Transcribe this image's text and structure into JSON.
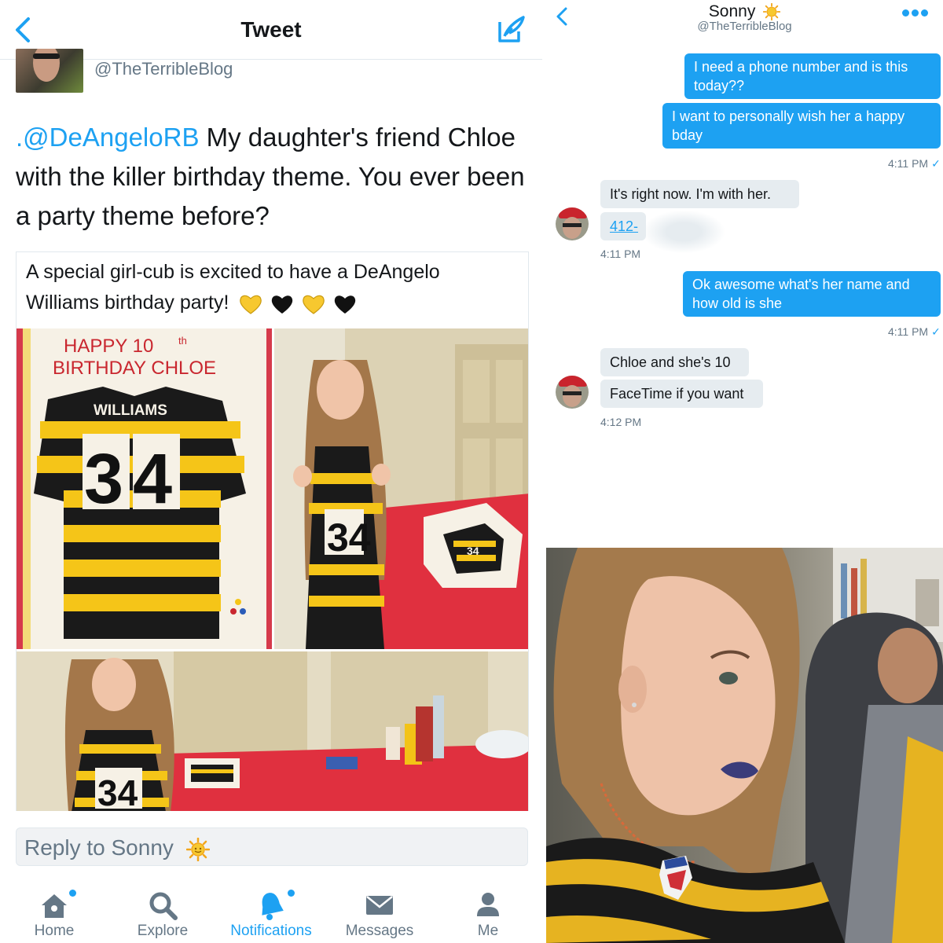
{
  "tweet_view": {
    "header": {
      "title": "Tweet"
    },
    "author": {
      "handle": "@TheTerribleBlog"
    },
    "tweet": {
      "mention": ".@DeAngeloRB",
      "body": " My daughter's friend Chloe with the killer birthday theme. You ever been a party theme before?"
    },
    "quoted": {
      "text": "A special girl-cub is excited to have a DeAngelo Williams birthday party!",
      "hearts": [
        "yellow",
        "black",
        "yellow",
        "black"
      ]
    },
    "photos": {
      "cake": {
        "line1": "HAPPY  10",
        "line1_sup": "th",
        "line2": "BIRTHDAY CHLOE",
        "name": "WILLIAMS",
        "number": "34"
      },
      "girl": {
        "number": "34"
      },
      "table": {
        "number": "34"
      }
    },
    "reply": {
      "placeholder": "Reply to Sonny"
    },
    "tabs": [
      {
        "label": "Home",
        "icon": "home-icon",
        "dot": true,
        "active": false
      },
      {
        "label": "Explore",
        "icon": "search-icon",
        "dot": false,
        "active": false
      },
      {
        "label": "Notifications",
        "icon": "bell-icon",
        "dot": true,
        "active": true
      },
      {
        "label": "Messages",
        "icon": "envelope-icon",
        "dot": false,
        "active": false
      },
      {
        "label": "Me",
        "icon": "person-icon",
        "dot": false,
        "active": false
      }
    ]
  },
  "dm_view": {
    "contact": {
      "name": "Sonny",
      "handle": "@TheTerribleBlog"
    },
    "messages": [
      {
        "from": "me",
        "text_lines": [
          "I need a phone number and is this",
          "today??"
        ]
      },
      {
        "from": "me",
        "text_lines": [
          "I want to personally wish her a happy",
          "bday"
        ]
      },
      {
        "from": "them",
        "text_lines": [
          "It's right now. I'm with her."
        ]
      },
      {
        "from": "them",
        "text_lines": [
          "412-"
        ]
      },
      {
        "from": "me",
        "text_lines": [
          "Ok awesome what's her name and",
          "how old is she"
        ]
      },
      {
        "from": "them",
        "text_lines": [
          "Chloe and she's 10"
        ]
      },
      {
        "from": "them",
        "text_lines": [
          "FaceTime if you want"
        ]
      }
    ],
    "timestamps": [
      "4:11 PM",
      "4:11 PM",
      "4:11 PM",
      "4:12 PM"
    ],
    "read_mark": "✓"
  },
  "colors": {
    "accent": "#1da1f2",
    "text": "#14171a",
    "muted": "#657786",
    "bubble_received": "#e6ecf0",
    "steelers_gold": "#f5c518",
    "steelers_black": "#111111",
    "tablecloth_red": "#e0303f"
  }
}
